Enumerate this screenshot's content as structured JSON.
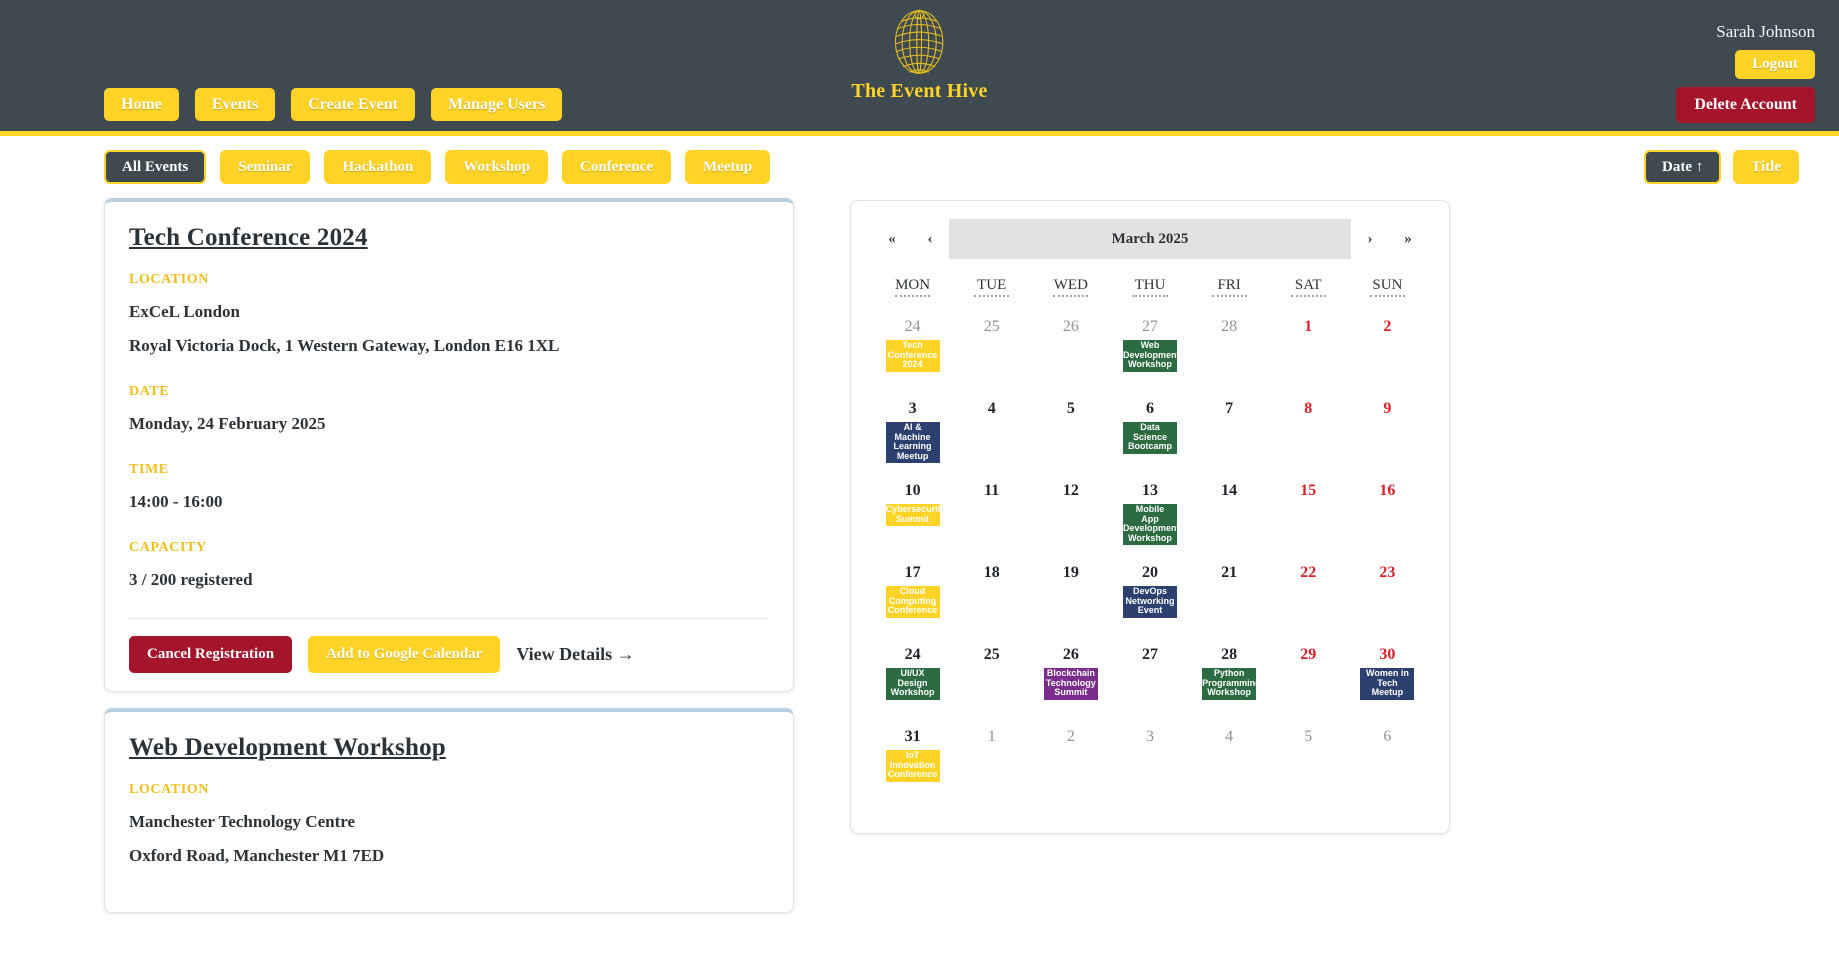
{
  "header": {
    "brand_name": "The Event Hive",
    "logo_icon": "beehive-globe-icon",
    "nav": [
      {
        "label": "Home",
        "name": "home"
      },
      {
        "label": "Events",
        "name": "events"
      },
      {
        "label": "Create Event",
        "name": "create-event"
      },
      {
        "label": "Manage Users",
        "name": "manage-users"
      }
    ],
    "user_name": "Sarah Johnson",
    "logout_label": "Logout",
    "delete_account_label": "Delete Account",
    "colors": {
      "bar": "#3e4a50",
      "accent": "#ffd426",
      "danger": "#a4142a"
    }
  },
  "filters": {
    "categories": [
      {
        "label": "All Events",
        "active": true
      },
      {
        "label": "Seminar",
        "active": false
      },
      {
        "label": "Hackathon",
        "active": false
      },
      {
        "label": "Workshop",
        "active": false
      },
      {
        "label": "Conference",
        "active": false
      },
      {
        "label": "Meetup",
        "active": false
      }
    ],
    "sorts": [
      {
        "label": "Date ↑",
        "active": true
      },
      {
        "label": "Title",
        "active": false
      }
    ]
  },
  "labels": {
    "location": "LOCATION",
    "date": "DATE",
    "time": "TIME",
    "capacity": "CAPACITY"
  },
  "events": [
    {
      "title": "Tech Conference 2024",
      "venue": "ExCeL London",
      "address": "Royal Victoria Dock, 1 Western Gateway, London E16 1XL",
      "date": "Monday, 24 February 2025",
      "time": "14:00 - 16:00",
      "capacity": "3 / 200 registered",
      "actions": {
        "cancel": "Cancel Registration",
        "calendar": "Add to Google Calendar",
        "details": "View Details →"
      }
    },
    {
      "title": "Web Development Workshop",
      "venue": "Manchester Technology Centre",
      "address": "Oxford Road, Manchester M1 7ED"
    }
  ],
  "calendar": {
    "title": "March 2025",
    "nav": {
      "first": "«",
      "prev": "‹",
      "next": "›",
      "last": "»"
    },
    "weekdays": [
      "MON",
      "TUE",
      "WED",
      "THU",
      "FRI",
      "SAT",
      "SUN"
    ],
    "event_colors": {
      "conference": "#ffd426",
      "workshop": "#2d6b43",
      "meetup": "#2c4170",
      "summit": "#7b2d8e"
    },
    "weeks": [
      [
        {
          "day": "24",
          "muted": true,
          "events": [
            {
              "lines": [
                "Tech",
                "Conference",
                "2024"
              ],
              "color": "#ffd426"
            }
          ]
        },
        {
          "day": "25",
          "muted": true,
          "events": []
        },
        {
          "day": "26",
          "muted": true,
          "events": []
        },
        {
          "day": "27",
          "muted": true,
          "events": [
            {
              "lines": [
                "Web",
                "Development",
                "Workshop"
              ],
              "color": "#2d6b43"
            }
          ]
        },
        {
          "day": "28",
          "muted": true,
          "events": []
        },
        {
          "day": "1",
          "muted": false,
          "weekend": true,
          "events": []
        },
        {
          "day": "2",
          "muted": false,
          "weekend": true,
          "events": []
        }
      ],
      [
        {
          "day": "3",
          "muted": false,
          "events": [
            {
              "lines": [
                "AI &",
                "Machine",
                "Learning",
                "Meetup"
              ],
              "color": "#2c4170"
            }
          ]
        },
        {
          "day": "4",
          "muted": false,
          "events": []
        },
        {
          "day": "5",
          "muted": false,
          "events": []
        },
        {
          "day": "6",
          "muted": false,
          "events": [
            {
              "lines": [
                "Data",
                "Science",
                "Bootcamp"
              ],
              "color": "#2d6b43"
            }
          ]
        },
        {
          "day": "7",
          "muted": false,
          "events": []
        },
        {
          "day": "8",
          "muted": false,
          "weekend": true,
          "events": []
        },
        {
          "day": "9",
          "muted": false,
          "weekend": true,
          "events": []
        }
      ],
      [
        {
          "day": "10",
          "muted": false,
          "events": [
            {
              "lines": [
                "Cybersecurity",
                "Summit"
              ],
              "color": "#ffd426"
            }
          ]
        },
        {
          "day": "11",
          "muted": false,
          "events": []
        },
        {
          "day": "12",
          "muted": false,
          "events": []
        },
        {
          "day": "13",
          "muted": false,
          "events": [
            {
              "lines": [
                "Mobile",
                "App",
                "Development",
                "Workshop"
              ],
              "color": "#2d6b43"
            }
          ]
        },
        {
          "day": "14",
          "muted": false,
          "events": []
        },
        {
          "day": "15",
          "muted": false,
          "weekend": true,
          "events": []
        },
        {
          "day": "16",
          "muted": false,
          "weekend": true,
          "events": []
        }
      ],
      [
        {
          "day": "17",
          "muted": false,
          "events": [
            {
              "lines": [
                "Cloud",
                "Computing",
                "Conference"
              ],
              "color": "#ffd426"
            }
          ]
        },
        {
          "day": "18",
          "muted": false,
          "events": []
        },
        {
          "day": "19",
          "muted": false,
          "events": []
        },
        {
          "day": "20",
          "muted": false,
          "events": [
            {
              "lines": [
                "DevOps",
                "Networking",
                "Event"
              ],
              "color": "#2c4170"
            }
          ]
        },
        {
          "day": "21",
          "muted": false,
          "events": []
        },
        {
          "day": "22",
          "muted": false,
          "weekend": true,
          "events": []
        },
        {
          "day": "23",
          "muted": false,
          "weekend": true,
          "events": []
        }
      ],
      [
        {
          "day": "24",
          "muted": false,
          "events": [
            {
              "lines": [
                "UI/UX",
                "Design",
                "Workshop"
              ],
              "color": "#2d6b43"
            }
          ]
        },
        {
          "day": "25",
          "muted": false,
          "events": []
        },
        {
          "day": "26",
          "muted": false,
          "events": [
            {
              "lines": [
                "Blockchain",
                "Technology",
                "Summit"
              ],
              "color": "#7b2d8e"
            }
          ]
        },
        {
          "day": "27",
          "muted": false,
          "events": []
        },
        {
          "day": "28",
          "muted": false,
          "events": [
            {
              "lines": [
                "Python",
                "Programming",
                "Workshop"
              ],
              "color": "#2d6b43"
            }
          ]
        },
        {
          "day": "29",
          "muted": false,
          "weekend": true,
          "events": []
        },
        {
          "day": "30",
          "muted": false,
          "weekend": true,
          "events": [
            {
              "lines": [
                "Women in",
                "Tech",
                "Meetup"
              ],
              "color": "#2c4170"
            }
          ]
        }
      ],
      [
        {
          "day": "31",
          "muted": false,
          "events": [
            {
              "lines": [
                "IoT",
                "Innovation",
                "Conference"
              ],
              "color": "#ffd426"
            }
          ]
        },
        {
          "day": "1",
          "muted": true,
          "events": []
        },
        {
          "day": "2",
          "muted": true,
          "events": []
        },
        {
          "day": "3",
          "muted": true,
          "events": []
        },
        {
          "day": "4",
          "muted": true,
          "events": []
        },
        {
          "day": "5",
          "muted": true,
          "events": []
        },
        {
          "day": "6",
          "muted": true,
          "events": []
        }
      ]
    ]
  }
}
